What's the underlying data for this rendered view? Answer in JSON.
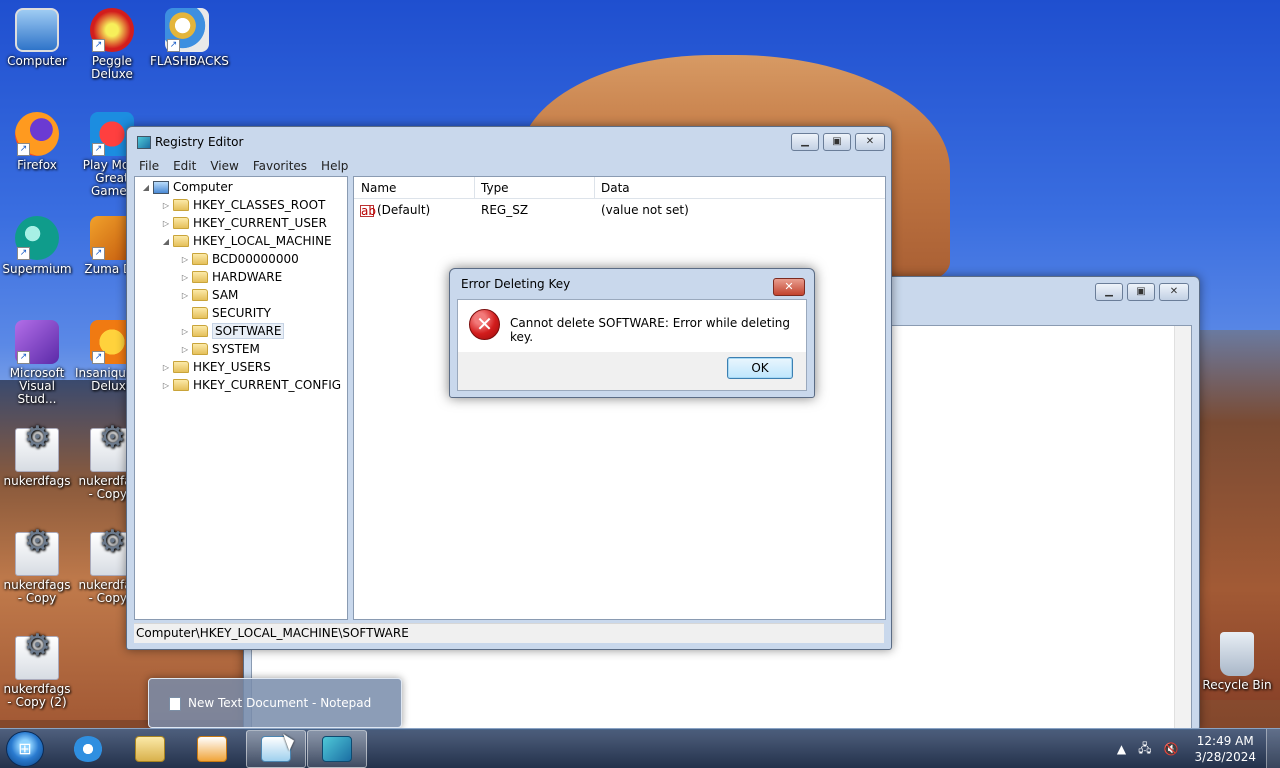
{
  "desktop": {
    "icons": [
      {
        "label": "Computer",
        "icon": "computer-icon"
      },
      {
        "label": "Peggle Deluxe",
        "icon": "peggle-icon"
      },
      {
        "label": "FLASHBACKS",
        "icon": "paint-palette-icon"
      },
      {
        "label": "Firefox",
        "icon": "firefox-icon"
      },
      {
        "label": "Play More Great Games",
        "icon": "play-games-icon"
      },
      {
        "label": "Supermium",
        "icon": "supermium-icon"
      },
      {
        "label": "Zuma De",
        "icon": "zuma-icon"
      },
      {
        "label": "Microsoft Visual Stud...",
        "icon": "visual-studio-icon"
      },
      {
        "label": "Insaniquarium Deluxe",
        "icon": "insaniquarium-icon"
      },
      {
        "label": "nukerdfags",
        "icon": "config-file-icon"
      },
      {
        "label": "nukerdfags - Copy (",
        "icon": "config-file-icon"
      },
      {
        "label": "nukerdfags - Copy",
        "icon": "config-file-icon"
      },
      {
        "label": "nukerdfags - Copy (",
        "icon": "config-file-icon"
      },
      {
        "label": "nukerdfags - Copy (2)",
        "icon": "config-file-icon"
      },
      {
        "label": "Recycle Bin",
        "icon": "recycle-bin-icon"
      }
    ]
  },
  "regedit": {
    "title": "Registry Editor",
    "menu": [
      "File",
      "Edit",
      "View",
      "Favorites",
      "Help"
    ],
    "tree": {
      "root": "Computer",
      "hives": [
        "HKEY_CLASSES_ROOT",
        "HKEY_CURRENT_USER",
        "HKEY_LOCAL_MACHINE"
      ],
      "hklm_children": [
        "BCD00000000",
        "HARDWARE",
        "SAM",
        "SECURITY",
        "SOFTWARE",
        "SYSTEM"
      ],
      "hives_after": [
        "HKEY_USERS",
        "HKEY_CURRENT_CONFIG"
      ]
    },
    "columns": {
      "name": "Name",
      "type": "Type",
      "data": "Data"
    },
    "rows": [
      {
        "name": "(Default)",
        "type": "REG_SZ",
        "data": "(value not set)"
      }
    ],
    "status": "Computer\\HKEY_LOCAL_MACHINE\\SOFTWARE"
  },
  "error_dialog": {
    "title": "Error Deleting Key",
    "message": "Cannot delete SOFTWARE:  Error while deleting key.",
    "ok": "OK",
    "close": "✕"
  },
  "thumbnail": {
    "label": "New Text Document - Notepad"
  },
  "taskbar": {
    "clock_time": "12:49 AM",
    "clock_date": "3/28/2024"
  }
}
